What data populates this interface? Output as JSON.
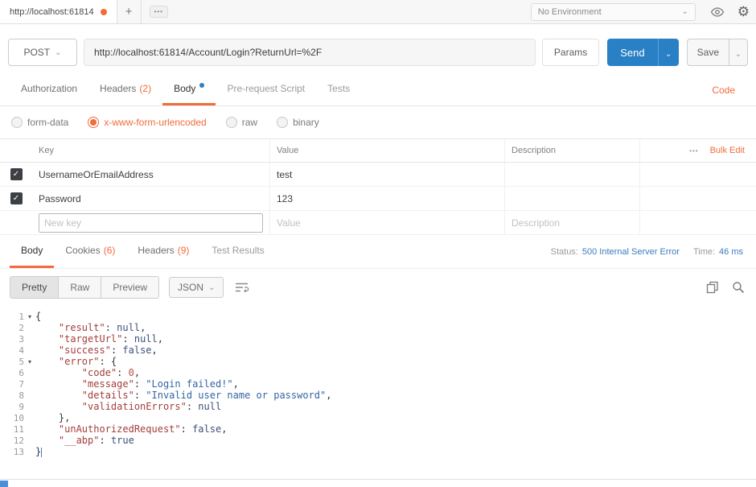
{
  "colors": {
    "accent_orange": "#f26b3a",
    "send_blue": "#2a80c4",
    "status_blue": "#3b7bbf",
    "body_dot_blue": "#2d7fc1"
  },
  "icons": {
    "plus": "+",
    "more": "•••",
    "header_more": "•••",
    "chevron_down": "⌄",
    "gear": "⚙",
    "check": "✓"
  },
  "topbar": {
    "tab_title": "http://localhost:61814",
    "environment": "No Environment"
  },
  "request": {
    "method": "POST",
    "url": "http://localhost:61814/Account/Login?ReturnUrl=%2F",
    "params_label": "Params",
    "send_label": "Send",
    "save_label": "Save"
  },
  "request_tabs": {
    "items": [
      {
        "label": "Authorization",
        "count": ""
      },
      {
        "label": "Headers",
        "count": "(2)"
      },
      {
        "label": "Body",
        "count": ""
      },
      {
        "label": "Pre-request Script",
        "count": ""
      },
      {
        "label": "Tests",
        "count": ""
      }
    ],
    "code_link": "Code"
  },
  "body_modes": [
    "form-data",
    "x-www-form-urlencoded",
    "raw",
    "binary"
  ],
  "kv_table": {
    "headers": {
      "key": "Key",
      "value": "Value",
      "description": "Description"
    },
    "bulk_edit_label": "Bulk Edit",
    "rows": [
      {
        "key": "UsernameOrEmailAddress",
        "value": "test",
        "description": "",
        "checked": true
      },
      {
        "key": "Password",
        "value": "123",
        "description": "",
        "checked": true
      }
    ],
    "placeholders": {
      "key": "New key",
      "value": "Value",
      "description": "Description"
    }
  },
  "response": {
    "tabs": [
      {
        "label": "Body",
        "count": ""
      },
      {
        "label": "Cookies",
        "count": "(6)"
      },
      {
        "label": "Headers",
        "count": "(9)"
      },
      {
        "label": "Test Results",
        "count": ""
      }
    ],
    "status_label": "Status:",
    "status_value": "500 Internal Server Error",
    "time_label": "Time:",
    "time_value": "46 ms",
    "view_modes": [
      "Pretty",
      "Raw",
      "Preview"
    ],
    "active_view": "Pretty",
    "language": "JSON"
  },
  "editor": {
    "lines": [
      {
        "n": 1,
        "fold": true,
        "tokens": [
          [
            "pln",
            "{"
          ]
        ]
      },
      {
        "n": 2,
        "tokens": [
          [
            "pln",
            "    "
          ],
          [
            "key",
            "\"result\""
          ],
          [
            "pln",
            ": "
          ],
          [
            "atom",
            "null"
          ],
          [
            "pln",
            ","
          ]
        ]
      },
      {
        "n": 3,
        "tokens": [
          [
            "pln",
            "    "
          ],
          [
            "key",
            "\"targetUrl\""
          ],
          [
            "pln",
            ": "
          ],
          [
            "atom",
            "null"
          ],
          [
            "pln",
            ","
          ]
        ]
      },
      {
        "n": 4,
        "tokens": [
          [
            "pln",
            "    "
          ],
          [
            "key",
            "\"success\""
          ],
          [
            "pln",
            ": "
          ],
          [
            "atom",
            "false"
          ],
          [
            "pln",
            ","
          ]
        ]
      },
      {
        "n": 5,
        "fold": true,
        "tokens": [
          [
            "pln",
            "    "
          ],
          [
            "key",
            "\"error\""
          ],
          [
            "pln",
            ": {"
          ]
        ]
      },
      {
        "n": 6,
        "tokens": [
          [
            "pln",
            "        "
          ],
          [
            "key",
            "\"code\""
          ],
          [
            "pln",
            ": "
          ],
          [
            "num",
            "0"
          ],
          [
            "pln",
            ","
          ]
        ]
      },
      {
        "n": 7,
        "tokens": [
          [
            "pln",
            "        "
          ],
          [
            "key",
            "\"message\""
          ],
          [
            "pln",
            ": "
          ],
          [
            "str",
            "\"Login failed!\""
          ],
          [
            "pln",
            ","
          ]
        ]
      },
      {
        "n": 8,
        "tokens": [
          [
            "pln",
            "        "
          ],
          [
            "key",
            "\"details\""
          ],
          [
            "pln",
            ": "
          ],
          [
            "str",
            "\"Invalid user name or password\""
          ],
          [
            "pln",
            ","
          ]
        ]
      },
      {
        "n": 9,
        "tokens": [
          [
            "pln",
            "        "
          ],
          [
            "key",
            "\"validationErrors\""
          ],
          [
            "pln",
            ": "
          ],
          [
            "atom",
            "null"
          ]
        ]
      },
      {
        "n": 10,
        "tokens": [
          [
            "pln",
            "    },"
          ]
        ]
      },
      {
        "n": 11,
        "tokens": [
          [
            "pln",
            "    "
          ],
          [
            "key",
            "\"unAuthorizedRequest\""
          ],
          [
            "pln",
            ": "
          ],
          [
            "atom",
            "false"
          ],
          [
            "pln",
            ","
          ]
        ]
      },
      {
        "n": 12,
        "tokens": [
          [
            "pln",
            "    "
          ],
          [
            "key",
            "\"__abp\""
          ],
          [
            "pln",
            ": "
          ],
          [
            "atom",
            "true"
          ]
        ]
      },
      {
        "n": 13,
        "cursor": true,
        "tokens": [
          [
            "pln",
            "}"
          ]
        ]
      }
    ]
  }
}
